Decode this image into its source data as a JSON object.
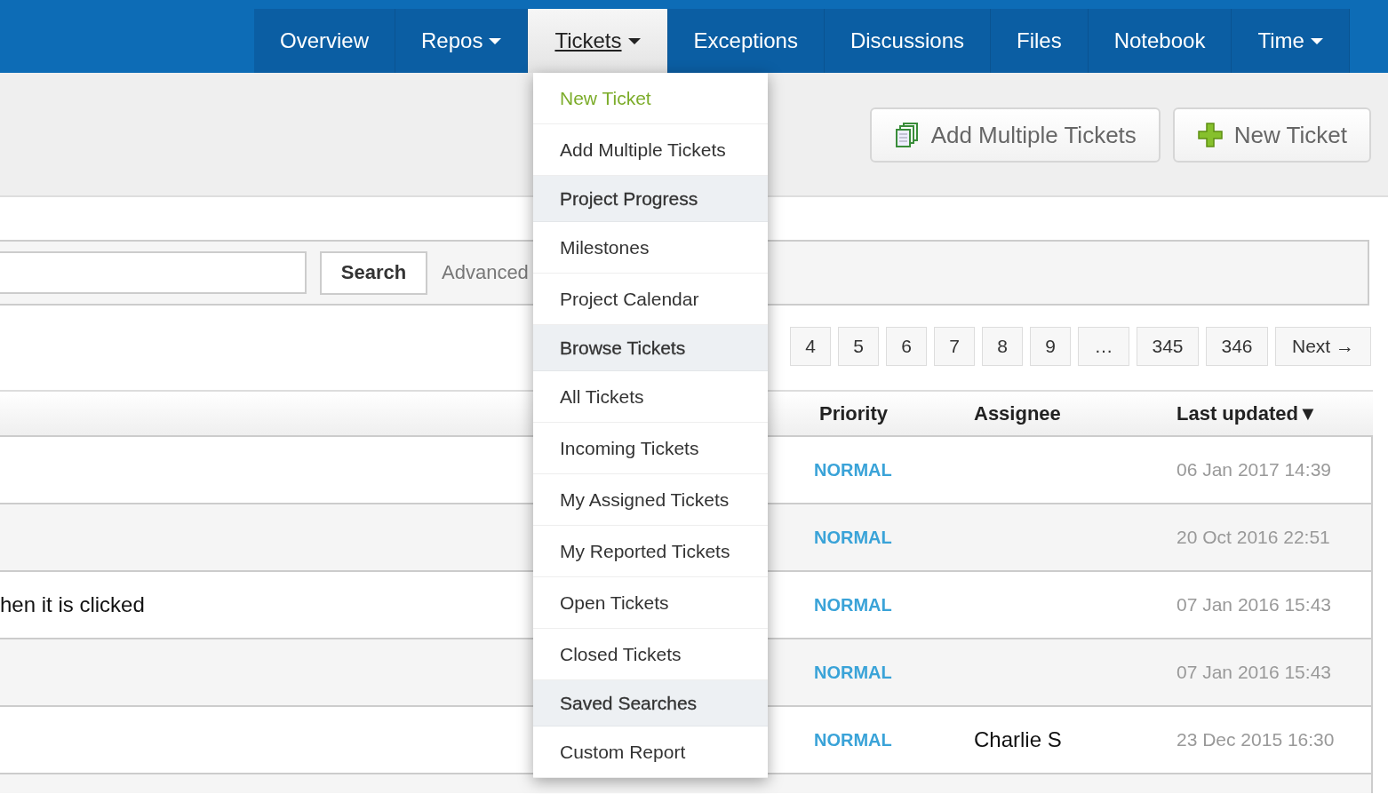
{
  "nav": {
    "tabs": [
      {
        "label": "Overview",
        "selected": false,
        "has_menu": false
      },
      {
        "label": "Repos",
        "selected": false,
        "has_menu": true
      },
      {
        "label": "Tickets",
        "selected": true,
        "has_menu": true
      },
      {
        "label": "Exceptions",
        "selected": false,
        "has_menu": false
      },
      {
        "label": "Discussions",
        "selected": false,
        "has_menu": false
      },
      {
        "label": "Files",
        "selected": false,
        "has_menu": false
      },
      {
        "label": "Notebook",
        "selected": false,
        "has_menu": false
      },
      {
        "label": "Time",
        "selected": false,
        "has_menu": true
      }
    ]
  },
  "toolbar": {
    "buttons": [
      {
        "label": "Add Multiple Tickets",
        "kind": "pages"
      },
      {
        "label": "New Ticket",
        "kind": "plus"
      }
    ]
  },
  "search": {
    "button": "Search",
    "advanced_link": "Advanced"
  },
  "pagination": {
    "pages": [
      "4",
      "5",
      "6",
      "7",
      "8",
      "9",
      "…",
      "345",
      "346"
    ],
    "next": "Next →"
  },
  "table": {
    "columns": [
      "Priority",
      "Assignee",
      "Last updated▼"
    ],
    "rows": [
      {
        "summary": "",
        "priority": "NORMAL",
        "assignee": "",
        "updated": "06 Jan 2017 14:39"
      },
      {
        "summary": "",
        "priority": "NORMAL",
        "assignee": "",
        "updated": "20 Oct 2016 22:51"
      },
      {
        "summary": "hen it is clicked",
        "priority": "NORMAL",
        "assignee": "",
        "updated": "07 Jan 2016 15:43"
      },
      {
        "summary": "",
        "priority": "NORMAL",
        "assignee": "",
        "updated": "07 Jan 2016 15:43"
      },
      {
        "summary": "",
        "priority": "NORMAL",
        "assignee": "Charlie S",
        "updated": "23 Dec 2015 16:30"
      }
    ]
  },
  "dropdown": {
    "items": [
      {
        "label": "New Ticket",
        "kind": "primary"
      },
      {
        "label": "Add Multiple Tickets",
        "kind": "link"
      },
      {
        "label": "Project Progress",
        "kind": "header"
      },
      {
        "label": "Milestones",
        "kind": "link"
      },
      {
        "label": "Project Calendar",
        "kind": "link"
      },
      {
        "label": "Browse Tickets",
        "kind": "header"
      },
      {
        "label": "All Tickets",
        "kind": "link"
      },
      {
        "label": "Incoming Tickets",
        "kind": "link"
      },
      {
        "label": "My Assigned Tickets",
        "kind": "link"
      },
      {
        "label": "My Reported Tickets",
        "kind": "link"
      },
      {
        "label": "Open Tickets",
        "kind": "link"
      },
      {
        "label": "Closed Tickets",
        "kind": "link"
      },
      {
        "label": "Saved Searches",
        "kind": "header"
      },
      {
        "label": "Custom Report",
        "kind": "link"
      }
    ]
  }
}
